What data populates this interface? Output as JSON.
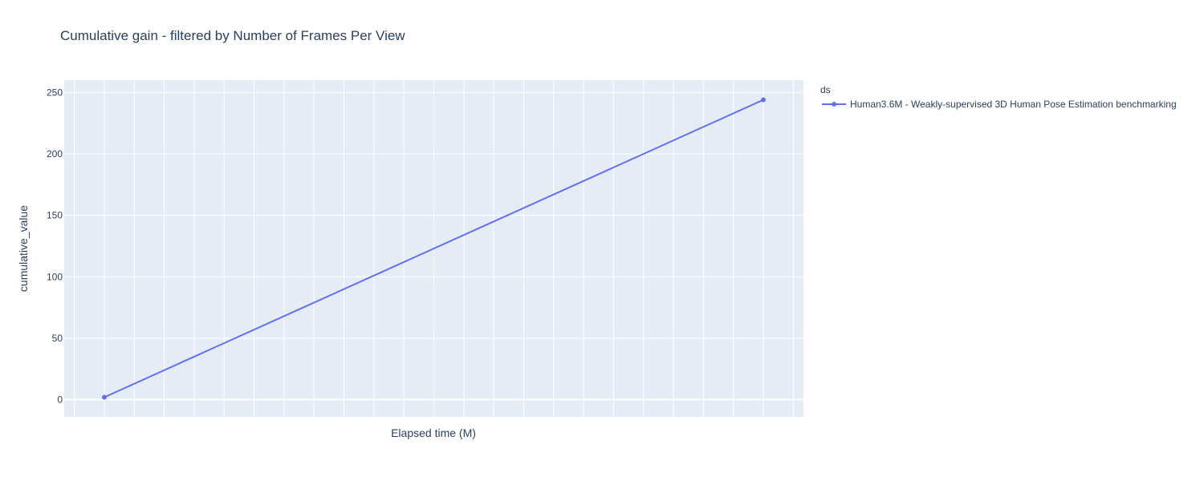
{
  "chart_data": {
    "type": "line",
    "title": "Cumulative gain - filtered by Number of Frames Per View",
    "xlabel": "Elapsed time (M)",
    "ylabel": "cumulative_value",
    "x_tick_labels": [],
    "ylim": [
      -14,
      260
    ],
    "y_ticks": [
      0,
      50,
      100,
      150,
      200,
      250
    ],
    "grid": true,
    "legend": {
      "title": "ds",
      "position": "top-right"
    },
    "series": [
      {
        "name": "Human3.6M - Weakly-supervised 3D Human Pose Estimation benchmarking",
        "color": "#636efa",
        "points": [
          {
            "x": 0,
            "y": 2
          },
          {
            "x": 1,
            "y": 244
          }
        ]
      }
    ]
  }
}
